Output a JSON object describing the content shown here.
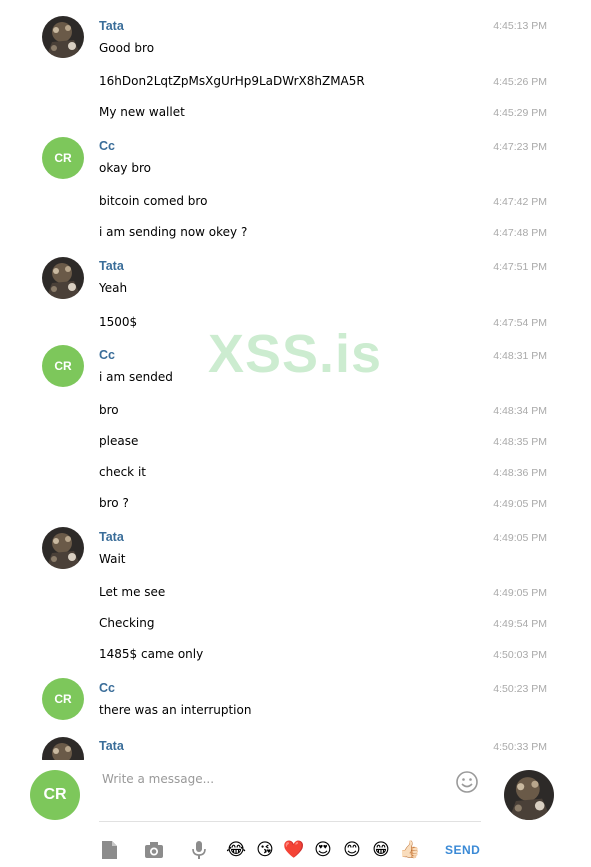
{
  "watermark": "XSS.is",
  "messages": [
    {
      "sender": "Tata",
      "text": "Good bro",
      "time": "4:45:13 PM"
    },
    {
      "text": "16hDon2LqtZpMsXgUrHp9LaDWrX8hZMA5R",
      "time": "4:45:26 PM"
    },
    {
      "text": "My new wallet",
      "time": "4:45:29 PM"
    },
    {
      "sender": "Cc",
      "avatar": "CR",
      "text": "okay bro",
      "time": "4:47:23 PM"
    },
    {
      "text": "bitcoin comed bro",
      "time": "4:47:42 PM"
    },
    {
      "text": "i am sending now okey ?",
      "time": "4:47:48 PM"
    },
    {
      "sender": "Tata",
      "text": "Yeah",
      "time": "4:47:51 PM"
    },
    {
      "text": "1500$",
      "time": "4:47:54 PM"
    },
    {
      "sender": "Cc",
      "avatar": "CR",
      "text": "i am sended",
      "time": "4:48:31 PM"
    },
    {
      "text": "bro",
      "time": "4:48:34 PM"
    },
    {
      "text": "please",
      "time": "4:48:35 PM"
    },
    {
      "text": "check it",
      "time": "4:48:36 PM"
    },
    {
      "text": "bro ?",
      "time": "4:49:05 PM"
    },
    {
      "sender": "Tata",
      "text": "Wait",
      "time": "4:49:05 PM"
    },
    {
      "text": "Let me see",
      "time": "4:49:05 PM"
    },
    {
      "text": "Checking",
      "time": "4:49:54 PM"
    },
    {
      "text": "1485$ came only",
      "time": "4:50:03 PM"
    },
    {
      "sender": "Cc",
      "avatar": "CR",
      "text": "there was an interruption",
      "time": "4:50:23 PM"
    },
    {
      "sender": "Tata",
      "text": "",
      "time": "4:50:33 PM"
    }
  ],
  "composer": {
    "avatar_initials": "CR",
    "placeholder": "Write a message...",
    "send_label": "SEND",
    "emoji_bar": [
      "😂",
      "😘",
      "❤️",
      "😍",
      "😊",
      "😁",
      "👍🏻"
    ]
  },
  "colors": {
    "sender_name": "#3a6d99",
    "timestamp": "#a9a9a9",
    "avatar_cr": "#7dc75b",
    "send": "#3b8ad6"
  }
}
